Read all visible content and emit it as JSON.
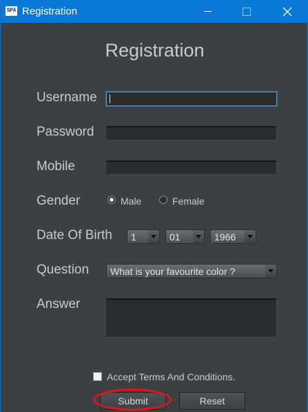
{
  "window": {
    "app_icon_text": "SPA",
    "title": "Registration"
  },
  "form": {
    "heading": "Registration",
    "username_label": "Username",
    "username_value": "",
    "password_label": "Password",
    "password_value": "",
    "mobile_label": "Mobile",
    "mobile_value": "",
    "gender_label": "Gender",
    "gender_options": [
      "Male",
      "Female"
    ],
    "gender_selected": "Male",
    "dob_label": "Date Of Birth",
    "dob_day": "1",
    "dob_month": "01",
    "dob_year": "1966",
    "question_label": "Question",
    "question_selected": "What is your favourite color ?",
    "answer_label": "Answer",
    "answer_value": "",
    "terms_label": "Accept Terms And Conditions.",
    "terms_checked": false,
    "submit_label": "Submit",
    "reset_label": "Reset"
  },
  "colors": {
    "titlebar": "#0a78d7",
    "background": "#3d4043",
    "highlight": "#e8111c"
  }
}
